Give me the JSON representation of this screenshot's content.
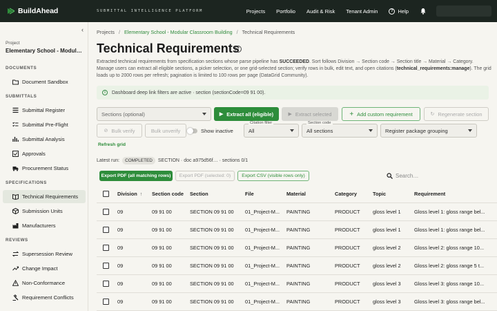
{
  "topbar": {
    "brand": "BuildAhead",
    "tagline": "SUBMITTAL INTELLIGENCE PLATFORM",
    "nav": [
      "Projects",
      "Portfolio",
      "Audit & Risk",
      "Tenant Admin"
    ],
    "help": "Help"
  },
  "sidebar": {
    "collapse_glyph": "‹",
    "project_label": "Project",
    "project_name": "Elementary School - Modular Classroom Building",
    "sections": [
      {
        "title": "DOCUMENTS",
        "items": [
          {
            "label": "Document Sandbox",
            "icon": "folder-icon"
          }
        ]
      },
      {
        "title": "SUBMITTALS",
        "items": [
          {
            "label": "Submittal Register",
            "icon": "list-icon"
          },
          {
            "label": "Submittal Pre-Flight",
            "icon": "checklist-icon"
          },
          {
            "label": "Submittal Analysis",
            "icon": "chart-icon"
          },
          {
            "label": "Approvals",
            "icon": "check-square-icon"
          },
          {
            "label": "Procurement Status",
            "icon": "truck-icon"
          }
        ]
      },
      {
        "title": "SPECIFICATIONS",
        "items": [
          {
            "label": "Technical Requirements",
            "icon": "book-icon",
            "active": true
          },
          {
            "label": "Submission Units",
            "icon": "box-icon"
          },
          {
            "label": "Manufacturers",
            "icon": "factory-icon"
          }
        ]
      },
      {
        "title": "REVIEWS",
        "items": [
          {
            "label": "Supersession Review",
            "icon": "swap-icon"
          },
          {
            "label": "Change Impact",
            "icon": "trend-icon"
          },
          {
            "label": "Non-Conformance",
            "icon": "warning-icon"
          },
          {
            "label": "Requirement Conflicts",
            "icon": "gavel-icon"
          }
        ]
      }
    ]
  },
  "breadcrumb": [
    "Projects",
    "Elementary School - Modular Classroom Building",
    "Technical Requirements"
  ],
  "page_title": "Technical Requirements",
  "description": {
    "part1": "Extracted technical requirements from specification sections whose parse pipeline has ",
    "bold1": "SUCCEEDED",
    "part2": ". Sort follows Division → Section code → Section title → Material → Category. Manage users can extract all eligible sections, a picker selection, or one grid-selected section; verify rows in bulk, edit text, and open citations (",
    "bold2": "technical_requirements:manage",
    "part3": "). The grid loads up to 2000 rows per refresh; pagination is limited to 100 rows per page (DataGrid Community)."
  },
  "alert": "Dashboard deep link filters are active · section (sectionCode=09 91 00).",
  "controls": {
    "sections_placeholder": "Sections (optional)",
    "extract_all": "Extract all (eligible)",
    "extract_selected": "Extract selected",
    "add_custom": "Add custom requirement",
    "regenerate": "Regenerate section",
    "bulk_verify": "Bulk verify",
    "bulk_unverify": "Bulk unverify",
    "show_inactive": "Show inactive",
    "citation_filter_label": "Citation filter",
    "citation_filter_value": "All",
    "section_code_label": "Section code",
    "section_code_value": "All sections",
    "package_grouping": "Register package grouping",
    "refresh_grid": "Refresh grid"
  },
  "last_run": {
    "label": "Latest run:",
    "status": "COMPLETED",
    "detail": "SECTION · doc a975d56f… · sections 0/1"
  },
  "exports": {
    "pdf_all": "Export PDF (all matching rows)",
    "pdf_selected": "Export PDF (selected: 0)",
    "csv_visible": "Export CSV (visible rows only)"
  },
  "search_placeholder": "Search…",
  "grid": {
    "columns": [
      "Division",
      "Section code",
      "Section",
      "File",
      "Material",
      "Category",
      "Topic",
      "Requirement"
    ],
    "sort_glyph": "↑",
    "rows": [
      [
        "09",
        "09 91 00",
        "SECTION 09 91 00",
        "01_Project-M...",
        "PAINTING",
        "PRODUCT",
        "gloss level 1",
        "Gloss level 1: gloss range bel..."
      ],
      [
        "09",
        "09 91 00",
        "SECTION 09 91 00",
        "01_Project-M...",
        "PAINTING",
        "PRODUCT",
        "gloss level 1",
        "Gloss level 1: gloss range bel..."
      ],
      [
        "09",
        "09 91 00",
        "SECTION 09 91 00",
        "01_Project-M...",
        "PAINTING",
        "PRODUCT",
        "gloss level 2",
        "Gloss level 2: gloss range 10..."
      ],
      [
        "09",
        "09 91 00",
        "SECTION 09 91 00",
        "01_Project-M...",
        "PAINTING",
        "PRODUCT",
        "gloss level 2",
        "Gloss level 2: gloss range 5 t..."
      ],
      [
        "09",
        "09 91 00",
        "SECTION 09 91 00",
        "01_Project-M...",
        "PAINTING",
        "PRODUCT",
        "gloss level 3",
        "Gloss level 3: gloss range 10..."
      ],
      [
        "09",
        "09 91 00",
        "SECTION 09 91 00",
        "01_Project-M...",
        "PAINTING",
        "PRODUCT",
        "gloss level 3",
        "Gloss level 3: gloss range bel..."
      ]
    ]
  },
  "colors": {
    "accent": "#2e8d3b",
    "topbar": "#1c2520"
  }
}
